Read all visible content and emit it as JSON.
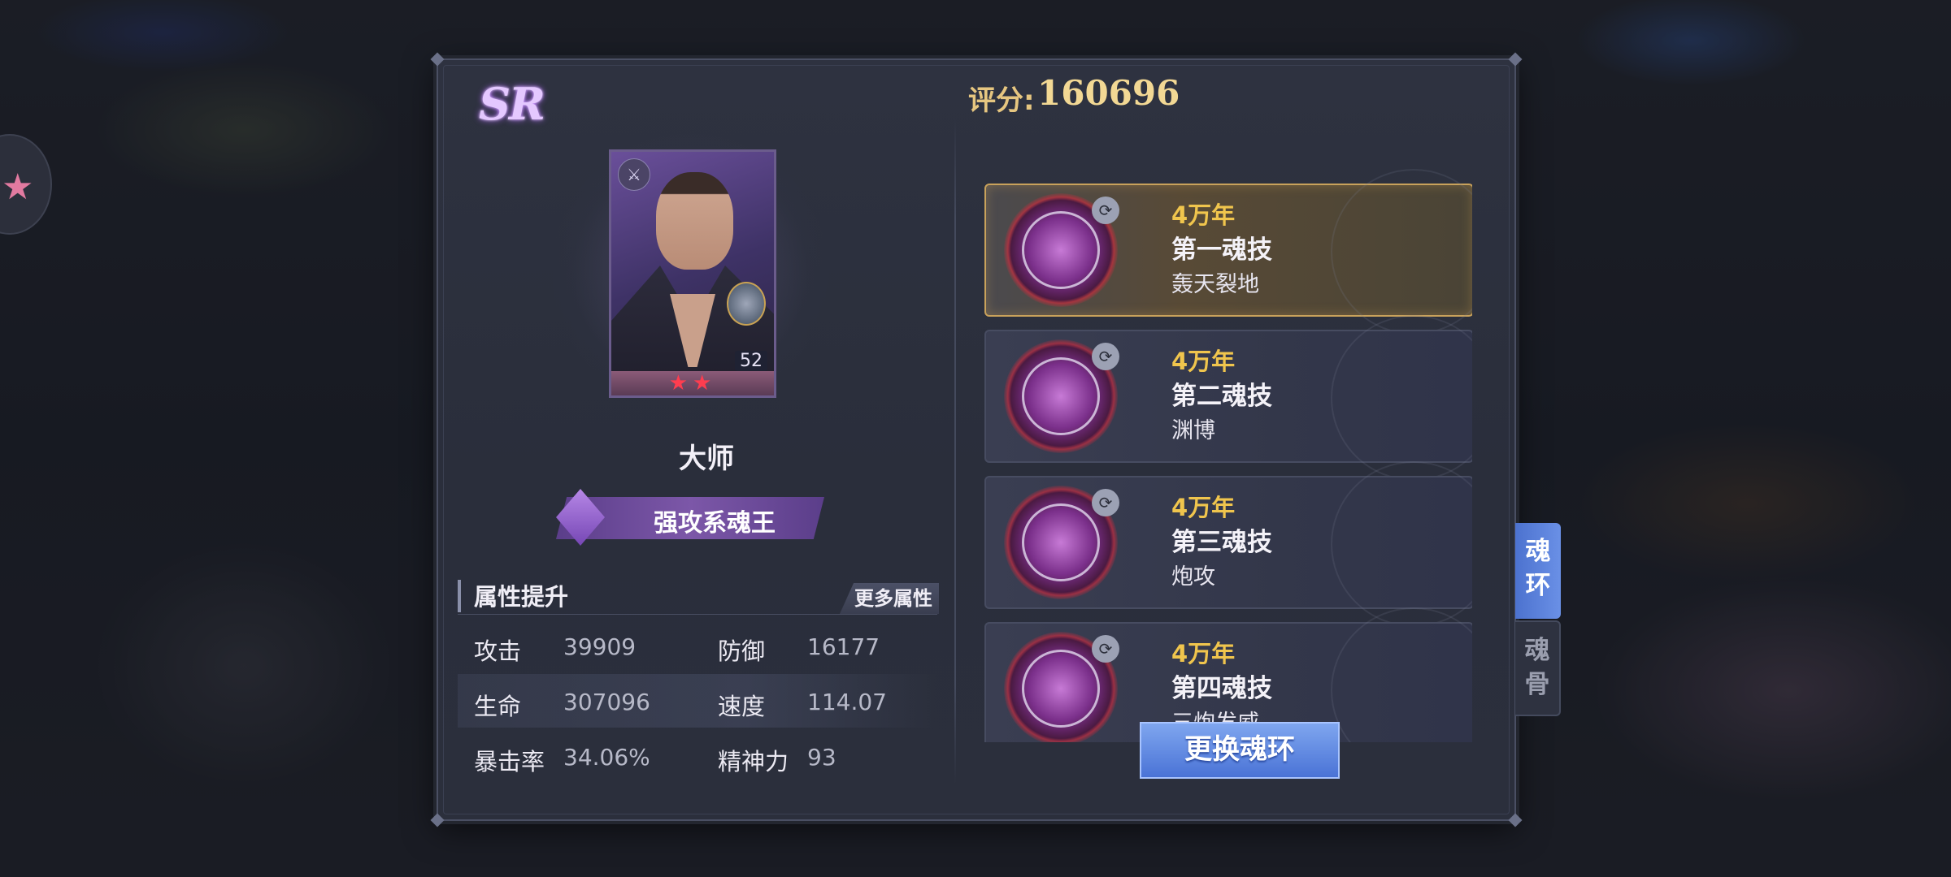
{
  "panel": {
    "rarity": "SR",
    "hero": {
      "name": "大师",
      "level": "52",
      "title": "强攻系魂王",
      "stars": "★★"
    },
    "stats": {
      "heading": "属性提升",
      "more_button": "更多属性",
      "rows": [
        {
          "l1": "攻击",
          "v1": "39909",
          "l2": "防御",
          "v2": "16177"
        },
        {
          "l1": "生命",
          "v1": "307096",
          "l2": "速度",
          "v2": "114.07"
        },
        {
          "l1": "暴击率",
          "v1": "34.06%",
          "l2": "精神力",
          "v2": "93"
        }
      ]
    },
    "score": {
      "label": "评分:",
      "value": "160696"
    },
    "rings": [
      {
        "year": "4万年",
        "name": "第一魂技",
        "skill": "轰天裂地",
        "selected": true
      },
      {
        "year": "4万年",
        "name": "第二魂技",
        "skill": "渊博",
        "selected": false
      },
      {
        "year": "4万年",
        "name": "第三魂技",
        "skill": "炮攻",
        "selected": false
      },
      {
        "year": "4万年",
        "name": "第四魂技",
        "skill": "三炮发威",
        "selected": false
      }
    ],
    "change_button": "更换魂环",
    "tabs": [
      {
        "label": "魂\n环",
        "active": true
      },
      {
        "label": "魂\n骨",
        "active": false
      }
    ]
  },
  "colors": {
    "gold": "#f0c54d",
    "active_tab": "#5a82dc",
    "button_blue": "#5b84e0",
    "title_purple": "#7c57a8"
  },
  "icons": [
    "sr-rarity-badge",
    "attack-type-icon",
    "pet-companion-icon",
    "soul-ring-orb-icon",
    "ring-badge-icon",
    "star-icon"
  ]
}
